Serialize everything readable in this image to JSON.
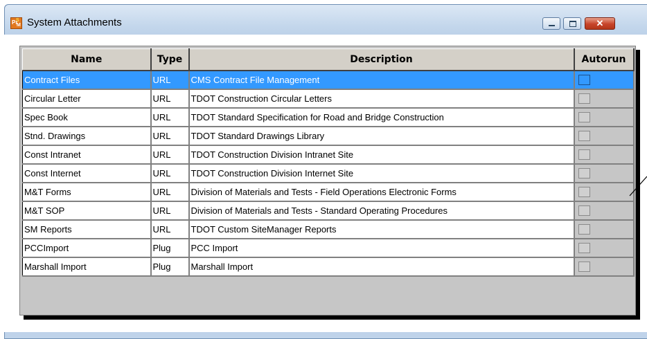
{
  "window": {
    "title": "System Attachments",
    "buttons": {
      "minimize": "minimize",
      "maximize": "maximize",
      "close": "close"
    }
  },
  "table": {
    "columns": [
      "Name",
      "Type",
      "Description",
      "Autorun"
    ],
    "rows": [
      {
        "name": "Contract Files",
        "type": "URL",
        "description": "CMS Contract File Management",
        "autorun": false,
        "selected": true
      },
      {
        "name": "Circular Letter",
        "type": "URL",
        "description": "TDOT Construction Circular Letters",
        "autorun": false
      },
      {
        "name": "Spec Book",
        "type": "URL",
        "description": "TDOT Standard Specification for Road and Bridge Construction",
        "autorun": false
      },
      {
        "name": "Stnd. Drawings",
        "type": "URL",
        "description": "TDOT Standard Drawings Library",
        "autorun": false
      },
      {
        "name": "Const Intranet",
        "type": "URL",
        "description": "TDOT Construction Division Intranet Site",
        "autorun": false
      },
      {
        "name": "Const Internet",
        "type": "URL",
        "description": "TDOT Construction Division Internet Site",
        "autorun": false
      },
      {
        "name": "M&T Forms",
        "type": "URL",
        "description": "Division of Materials and Tests - Field Operations Electronic Forms",
        "autorun": false
      },
      {
        "name": "M&T SOP",
        "type": "URL",
        "description": "Division of Materials and Tests - Standard Operating Procedures",
        "autorun": false
      },
      {
        "name": "SM Reports",
        "type": "URL",
        "description": "TDOT Custom SiteManager Reports",
        "autorun": false
      },
      {
        "name": "PCCImport",
        "type": "Plug",
        "description": "PCC Import",
        "autorun": false
      },
      {
        "name": "Marshall Import",
        "type": "Plug",
        "description": "Marshall Import",
        "autorun": false
      }
    ]
  },
  "colors": {
    "selection": "#3399ff",
    "titlebar": "#c4d7ec",
    "grid_background": "#c6c6c6"
  }
}
